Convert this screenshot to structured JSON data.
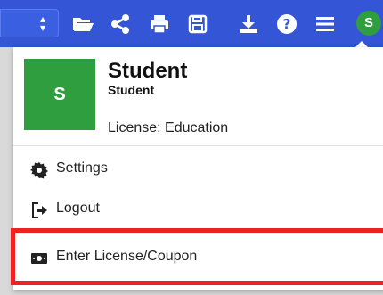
{
  "colors": {
    "toolbar": "#3355d6",
    "avatar": "#2e9e3e",
    "highlight": "#ee2222"
  },
  "toolbar": {
    "select_arrows": "⇕",
    "icons": [
      "folder-open-icon",
      "share-icon",
      "print-icon",
      "save-icon",
      "download-icon",
      "help-icon",
      "menu-icon"
    ],
    "avatar_initial": "S"
  },
  "profile": {
    "avatar_initial": "S",
    "name": "Student",
    "subtitle": "Student",
    "license": "License: Education"
  },
  "menu": {
    "settings": {
      "label": "Settings",
      "icon": "gear-icon"
    },
    "logout": {
      "label": "Logout",
      "icon": "logout-icon"
    },
    "license": {
      "label": "Enter License/Coupon",
      "icon": "ticket-icon"
    }
  }
}
